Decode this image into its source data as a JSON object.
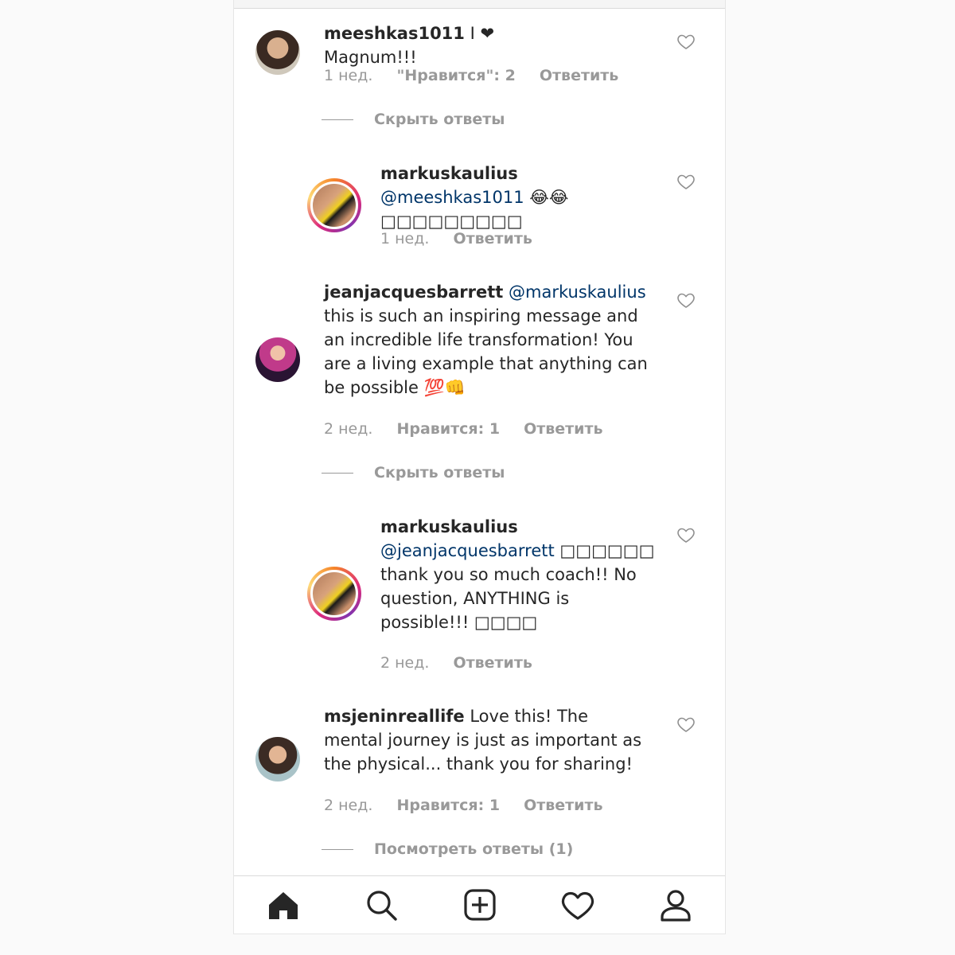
{
  "comments": [
    {
      "username": "meeshkas1011",
      "text": " I ❤ Magnum!!!",
      "time": "1 нед.",
      "likes": "\"Нравится\": 2",
      "reply": "Ответить",
      "thread_toggle": "Скрыть ответы"
    },
    {
      "username": "markuskaulius",
      "mention": "@meeshkas1011",
      "text": "😂😂□□□□□□□□□",
      "time": "1 нед.",
      "reply": "Ответить"
    },
    {
      "username": "jeanjacquesbarrett",
      "mention": "@markuskaulius",
      "text": " this is such an inspiring message and an incredible life transformation! You are a living example that anything can be possible 💯👊",
      "time": "2 нед.",
      "likes": "Нравится: 1",
      "reply": "Ответить",
      "thread_toggle": "Скрыть ответы"
    },
    {
      "username": "markuskaulius",
      "mention": "@jeanjacquesbarrett",
      "text": " □□□□□□ thank you so much coach!! No question, ANYTHING is possible!!! □□□□",
      "time": "2 нед.",
      "reply": "Ответить"
    },
    {
      "username": "msjeninreallife",
      "text": " Love this! The mental journey is just as important as the physical... thank you for sharing!",
      "time": "2 нед.",
      "likes": "Нравится: 1",
      "reply": "Ответить",
      "thread_toggle": "Посмотреть ответы (1)"
    }
  ],
  "nav": [
    "home-icon",
    "search-icon",
    "new-post-icon",
    "activity-heart-icon",
    "profile-icon"
  ],
  "colors": {
    "text": "#262626",
    "meta": "#999999",
    "mention": "#003569",
    "background": "#fafafa"
  }
}
